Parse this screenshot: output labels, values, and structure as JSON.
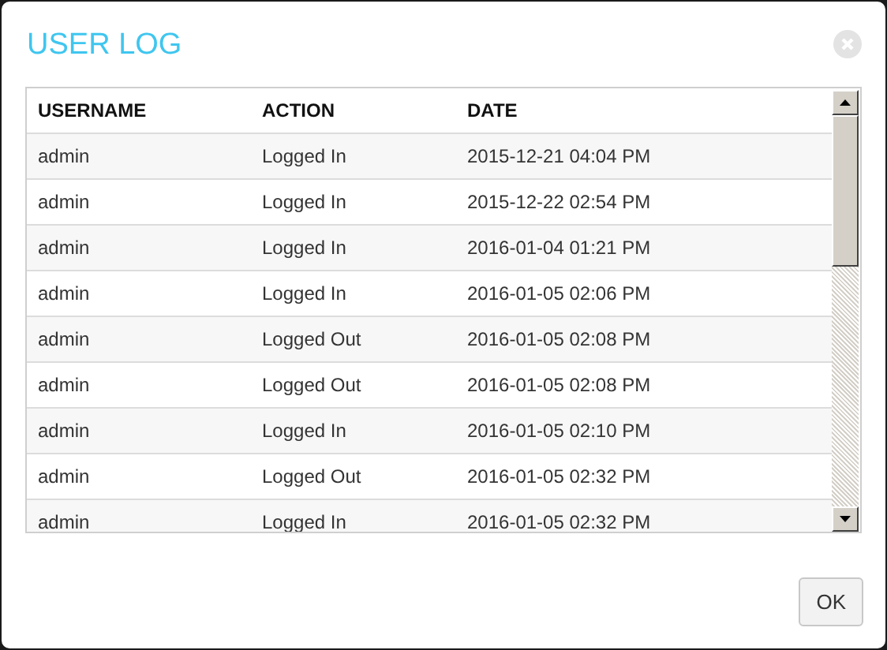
{
  "dialog": {
    "title": "USER LOG"
  },
  "table": {
    "columns": [
      "USERNAME",
      "ACTION",
      "DATE"
    ],
    "rows": [
      [
        "admin",
        "Logged In",
        "2015-12-21 04:04 PM"
      ],
      [
        "admin",
        "Logged In",
        "2015-12-22 02:54 PM"
      ],
      [
        "admin",
        "Logged In",
        "2016-01-04 01:21 PM"
      ],
      [
        "admin",
        "Logged In",
        "2016-01-05 02:06 PM"
      ],
      [
        "admin",
        "Logged Out",
        "2016-01-05 02:08 PM"
      ],
      [
        "admin",
        "Logged Out",
        "2016-01-05 02:08 PM"
      ],
      [
        "admin",
        "Logged In",
        "2016-01-05 02:10 PM"
      ],
      [
        "admin",
        "Logged Out",
        "2016-01-05 02:32 PM"
      ],
      [
        "admin",
        "Logged In",
        "2016-01-05 02:32 PM"
      ]
    ]
  },
  "buttons": [
    "OK"
  ]
}
